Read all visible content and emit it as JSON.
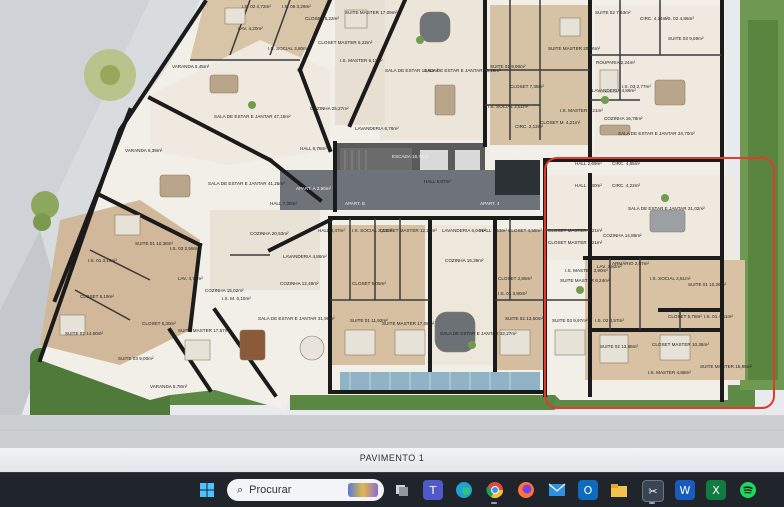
{
  "floor_plan": {
    "caption": "PAVIMENTO 1",
    "highlight_color": "#e5392b",
    "rooms": {
      "lav_topleft": "LAV. 4,20m²",
      "is02_topleft": "I.S. 02 4,72m²",
      "is05": "I.S. 05 3,29m²",
      "closet_top": "CLOSET 5,22m²",
      "suite_master_top": "SUITE MASTER 17,09m²",
      "is_social_top": "I.S. SOCIAL 3,80m²",
      "closet_master_top": "CLOSET MASTER 6,22m²",
      "is_master_top": "I.S. MASTER 6,11m²",
      "varanda_top": "VARANDA 6,45m²",
      "sala_jantar_1": "SALA DE ESTAR E JANTAR 47,15m²",
      "cozinha_1": "COZINHA 25,27m²",
      "sala_estar_2": "SALA DE ESTAR 14,63m²",
      "sala_estar_jantar_3": "SALA DE ESTAR E JANTAR 41,25m²",
      "varanda_mid": "VARANDA 6,39m²",
      "sala_estar_jantar_4": "SALA DE ESTAR E JANTAR 63,16m²",
      "lavanderia_1": "LAVANDERIA 6,76m²",
      "escada": "ESCADA 16,72m²",
      "hall_1": "HALL 5,67m²",
      "hall_2": "HALL 6,78m²",
      "hall_3": "HALL 7,30m²",
      "apart_a": "APART. A 3,90m²",
      "apart_b": "APART. B",
      "apart_4": "APART. 4",
      "apart_1": "APART. 1 - 62,35m²",
      "cozinha_2": "COZINHA 20,53m²",
      "suite_1": "SUITE 01 10,38m²",
      "is_01_a": "I.S. 01 3,14m²",
      "is_03": "I.S. 03 2,59m²",
      "closet_2": "CLOSET 5,19m²",
      "lav_2": "LAV. 4,71m²",
      "cozinha_3": "COZINHA 15,02m²",
      "is_m": "I.S. M. 6,10m²",
      "suite_02_l": "SUITE 02 14,60m²",
      "suite_03_l": "SUITE 03 9,00m²",
      "suite_master_l": "SUITE MASTER 17,57m²",
      "closet_3": "CLOSET 5,30m²",
      "varanda_low": "VARANDA 5,78m²",
      "cozinha_4": "COZINHA 12,49m²",
      "sala_jantar_5": "SALA DE ESTAR E JANTAR 31,99m²",
      "lavanderia_2": "LAVANDERIA 4,86m²",
      "hall_mid": "HALL 4,47m²",
      "is_social_m": "I.S. SOCIAL 3,45m²",
      "closet_master_m": "CLOSET MASTER 12,27m²",
      "lavanderia_3": "LAVANDERIA 6,04m²",
      "cozinha_5": "COZINHA 16,39m²",
      "sala_jantar_6": "SALA DE ESTAR E JANTAR 32,27m²",
      "suite_m2": "SUITE MASTER 17,08m²",
      "closet_4": "CLOSET 5,05m²",
      "suite_01_m": "SUITE 01 11,92m²",
      "suite_02_m": "SUITE 02 13,50m²",
      "suite_03_m": "SUITE 03 9,97m²",
      "is_01_m": "I.S. 01 3,80m²",
      "closet_m5": "CLOSET 2,85m²",
      "hall_r1": "HALL 3,63m²",
      "closet_master_r": "CLOSET MASTER 6,21m²",
      "closet_r": "CLOSET 4,58m²",
      "is_master_r": "I.S. MASTER 3,90m²",
      "suite_01_tr": "SUITE 01 9,90m²",
      "suite_master_tr": "SUITE MASTER 20,96m²",
      "closet_tr": "CLOSET 7,38m²",
      "is_social_tr": "I.S. SOCIAL 3,51m²",
      "circ_tr": "CIRC. 2,13m²",
      "is_master_tr": "I.S. MASTER 6,21m²",
      "closet_m_tr": "CLOSET M. 4,21m²",
      "roupaira": "ROUPARIA 2,24m²",
      "lavanderia_tr": "LAVANDERIA 4,86m²",
      "is_03_tr": "I.S. 03 2,77m²",
      "cozinha_tr": "COZINHA 16,78m²",
      "sala_jantar_tr": "SALA DE ESTAR E JANTAR 34,70m²",
      "circ_top": "CIRC. 4,14m²",
      "is_02_tr": "I.S. 02 4,86m²",
      "suite_02_tr": "SUITE 02 7,63m²",
      "suite_03_tr": "SUITE 03 9,69m²",
      "hall_h1": "HALL 2,69m²",
      "circ_h1": "CIRC. 4,65m²",
      "hall_h2": "HALL 5,40m²",
      "circ_h2": "CIRC. 4,22m²",
      "sala_jantar_h": "SALA DE ESTAR E JANTAR 31,02m²",
      "cozinha_h": "COZINHA 14,86m²",
      "closet_master_h": "CLOSET MASTER 6,21m²",
      "lav_h": "LAV. 3,82m²",
      "arm_h": "ARMÁRIO 2,57m²",
      "suite_master_h1": "SUITE MASTER 6,24m²",
      "is_social_h": "I.S. SOCIAL 2,51m²",
      "suite_01_h": "SUITE 01 10,26m²",
      "is_02_h": "I.S. 02 4,57m²",
      "closet_h": "CLOSET 5,78m²",
      "is_01_h": "I.S. 01 4,61m²",
      "suite_02_h": "SUITE 02 13,86m²",
      "closet_master_h2": "CLOSET MASTER 10,36m²",
      "is_master_h": "I.S. MASTER 4,88m²",
      "suite_master_h2": "SUITE MASTER 15,85m²"
    }
  },
  "taskbar": {
    "search_placeholder": "Procurar",
    "apps": [
      {
        "name": "windows-start-icon"
      },
      {
        "name": "task-view-icon"
      },
      {
        "name": "teams-icon"
      },
      {
        "name": "edge-icon"
      },
      {
        "name": "chrome-icon"
      },
      {
        "name": "firefox-icon"
      },
      {
        "name": "mail-icon"
      },
      {
        "name": "outlook-icon"
      },
      {
        "name": "file-explorer-icon"
      },
      {
        "name": "snipping-tool-icon"
      },
      {
        "name": "word-icon"
      },
      {
        "name": "excel-icon"
      },
      {
        "name": "spotify-icon"
      }
    ]
  }
}
